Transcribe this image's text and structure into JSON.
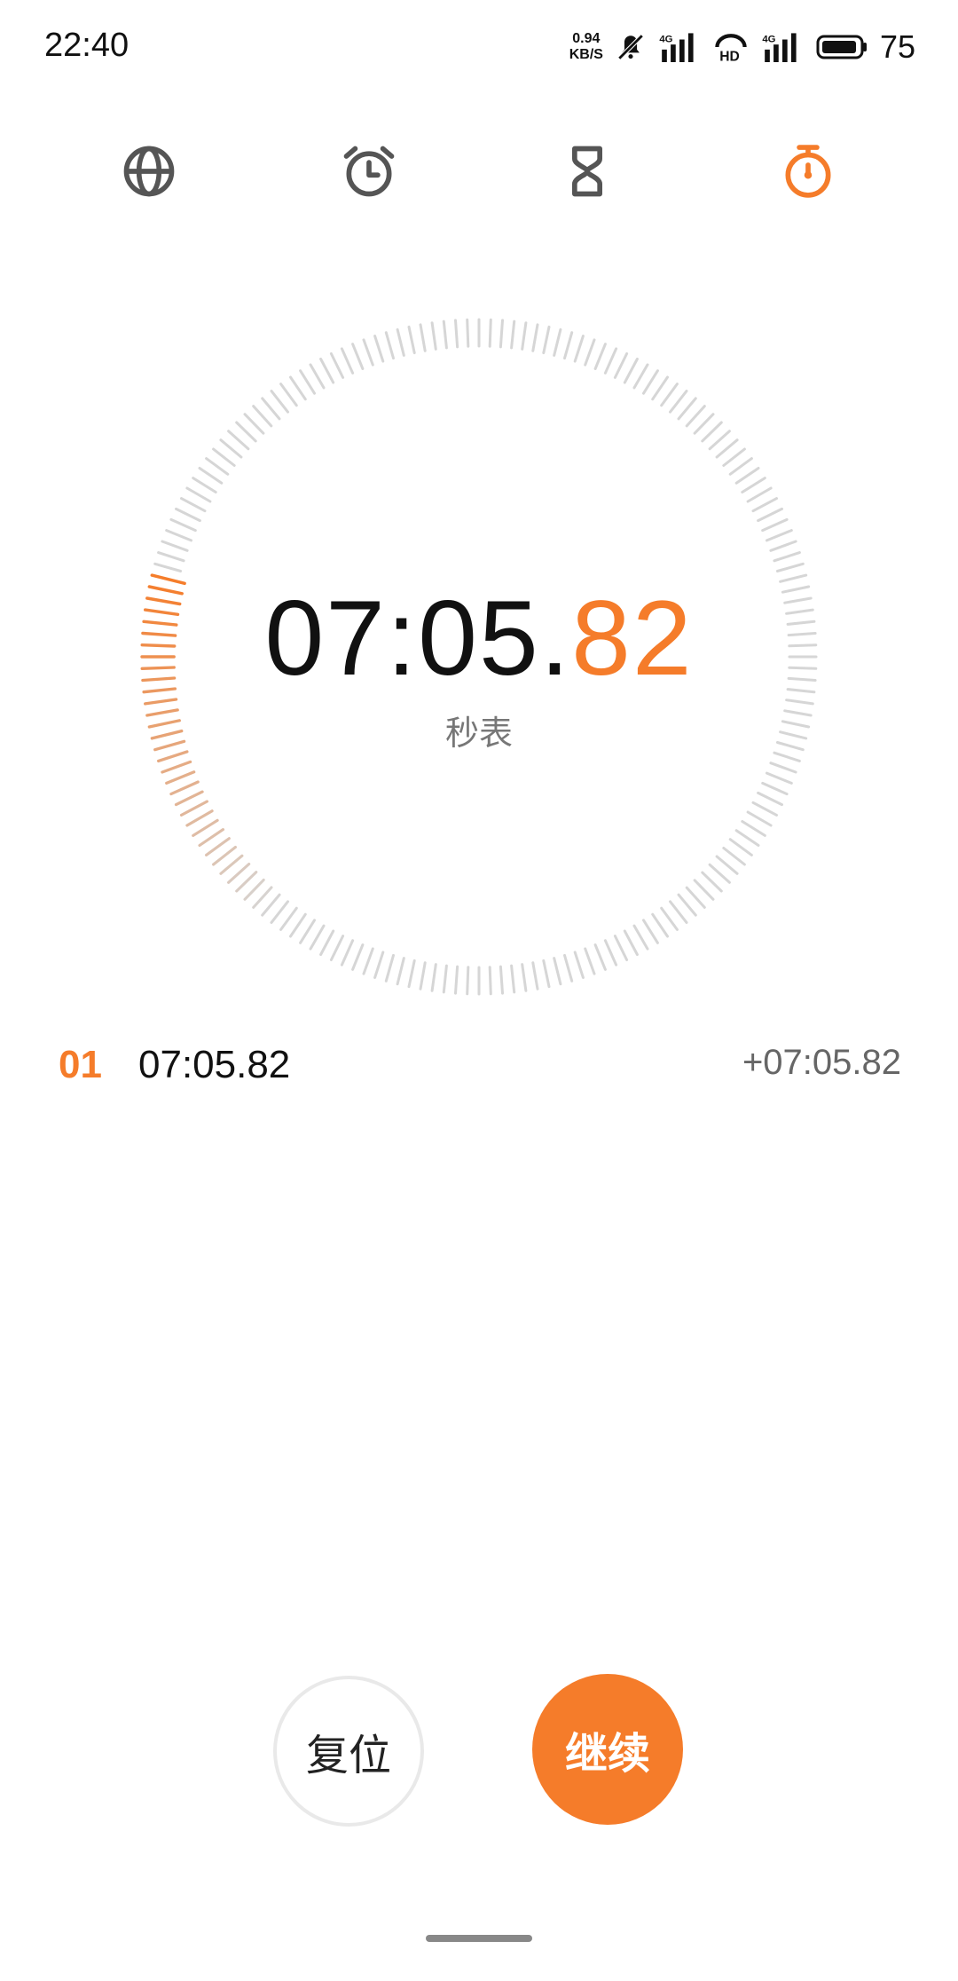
{
  "status_bar": {
    "time": "22:40",
    "net_speed_value": "0.94",
    "net_speed_unit": "KB/S",
    "battery": "75",
    "icons": [
      "bell-muted-icon",
      "signal-4g-icon",
      "hd-voice-icon",
      "signal-4g-icon",
      "battery-icon"
    ]
  },
  "tabs": [
    {
      "name": "world-clock",
      "icon": "globe-icon",
      "active": false
    },
    {
      "name": "alarm",
      "icon": "alarm-clock-icon",
      "active": false
    },
    {
      "name": "timer",
      "icon": "hourglass-icon",
      "active": false
    },
    {
      "name": "stopwatch",
      "icon": "stopwatch-icon",
      "active": true
    }
  ],
  "stopwatch": {
    "main": "07:05.",
    "centiseconds": "82",
    "label": "秒表"
  },
  "laps": [
    {
      "index": "01",
      "time": "07:05.82",
      "diff": "+07:05.82"
    }
  ],
  "buttons": {
    "reset": "复位",
    "continue": "继续"
  },
  "colors": {
    "accent": "#f57c2a",
    "tick_inactive": "#d6d6d6",
    "icon_gray": "#555555"
  }
}
